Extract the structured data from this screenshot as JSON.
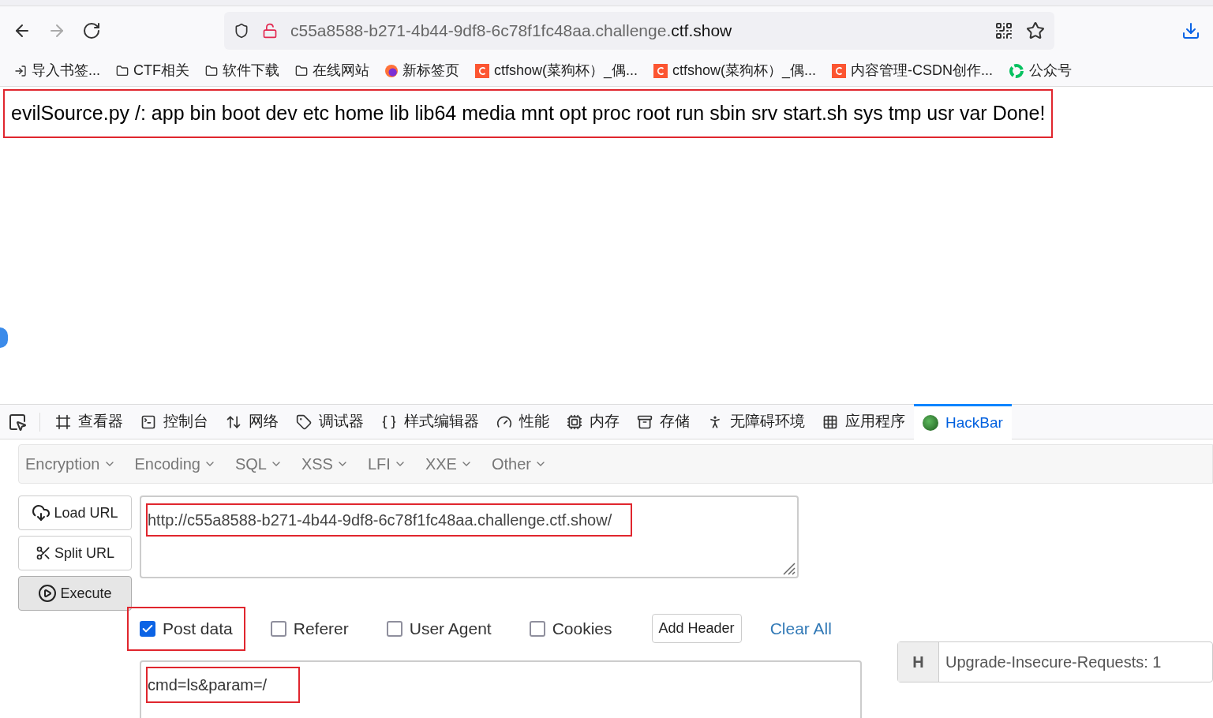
{
  "address_bar": {
    "url_prefix": "c55a8588-b271-4b44-9df8-6c78f1fc48aa.challenge.",
    "url_domain": "ctf.show"
  },
  "bookmarks": [
    {
      "kind": "import",
      "label": "导入书签..."
    },
    {
      "kind": "folder",
      "label": "CTF相关"
    },
    {
      "kind": "folder",
      "label": "软件下载"
    },
    {
      "kind": "folder",
      "label": "在线网站"
    },
    {
      "kind": "firefox",
      "label": "新标签页"
    },
    {
      "kind": "csdn",
      "label": "ctfshow(菜狗杯）_偶..."
    },
    {
      "kind": "csdn",
      "label": "ctfshow(菜狗杯）_偶..."
    },
    {
      "kind": "csdn",
      "label": "内容管理-CSDN创作..."
    },
    {
      "kind": "wechat",
      "label": "公众号"
    }
  ],
  "page": {
    "output": "evilSource.py /: app bin boot dev etc home lib lib64 media mnt opt proc root run sbin srv start.sh sys tmp usr var Done!",
    "annotated": true
  },
  "devtools_tabs": [
    {
      "kind": "inspector",
      "label": "查看器",
      "selected": false
    },
    {
      "kind": "console",
      "label": "控制台",
      "selected": false
    },
    {
      "kind": "network",
      "label": "网络",
      "selected": false
    },
    {
      "kind": "debugger",
      "label": "调试器",
      "selected": false
    },
    {
      "kind": "style",
      "label": "样式编辑器",
      "selected": false
    },
    {
      "kind": "performance",
      "label": "性能",
      "selected": false
    },
    {
      "kind": "memory",
      "label": "内存",
      "selected": false
    },
    {
      "kind": "storage",
      "label": "存储",
      "selected": false
    },
    {
      "kind": "accessibility",
      "label": "无障碍环境",
      "selected": false
    },
    {
      "kind": "application",
      "label": "应用程序",
      "selected": false
    },
    {
      "kind": "hackbar",
      "label": "HackBar",
      "selected": true
    }
  ],
  "hackbar": {
    "menus": [
      "Encryption",
      "Encoding",
      "SQL",
      "XSS",
      "LFI",
      "XXE",
      "Other"
    ],
    "buttons": [
      {
        "kind": "load",
        "label": "Load URL"
      },
      {
        "kind": "split",
        "label": "Split URL"
      },
      {
        "kind": "execute",
        "label": "Execute"
      }
    ],
    "url": {
      "value": "http://c55a8588-b271-4b44-9df8-6c78f1fc48aa.challenge.ctf.show/",
      "annotated": true
    },
    "options": [
      {
        "label": "Post data",
        "checked": true,
        "annotated": true
      },
      {
        "label": "Referer",
        "checked": false,
        "annotated": false
      },
      {
        "label": "User Agent",
        "checked": false,
        "annotated": false
      },
      {
        "label": "Cookies",
        "checked": false,
        "annotated": false
      }
    ],
    "add_header": "Add Header",
    "clear_all": "Clear All",
    "post_body": {
      "value": "cmd=ls&param=/",
      "annotated": true
    },
    "headers": [
      {
        "key": "H",
        "value": "Upgrade-Insecure-Requests: 1"
      }
    ]
  }
}
